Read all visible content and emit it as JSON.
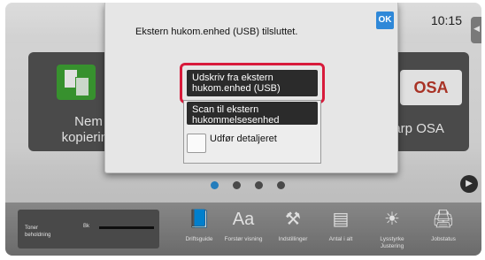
{
  "status": {
    "time": "10:15"
  },
  "tiles": {
    "copy": {
      "label_line1": "Nem",
      "label_line2": "kopiering"
    },
    "osa": {
      "label": "harp OSA",
      "logo_text": "OSA"
    }
  },
  "dialog": {
    "title": "Ekstern hukom.enhed (USB) tilsluttet.",
    "ok_label": "OK",
    "print_option": {
      "line1": "Udskriv fra ekstern",
      "line2": "hukom.enhed (USB)"
    },
    "scan_option": {
      "line1": "Scan til ekstern",
      "line2": "hukommelsesenhed"
    },
    "checkbox_label": "Udfør detaljeret"
  },
  "bottom_bar": {
    "toner": {
      "label_line1": "Toner",
      "label_line2": "beholdning",
      "channel": "Bk",
      "level": 1.0
    },
    "functions": [
      {
        "icon": "guide-icon",
        "label_line1": "Driftsguide",
        "label_line2": ""
      },
      {
        "icon": "magnify-text-icon",
        "label_line1": "Forstør visning",
        "label_line2": ""
      },
      {
        "icon": "tools-icon",
        "label_line1": "Indstillinger",
        "label_line2": ""
      },
      {
        "icon": "counter-icon",
        "label_line1": "Antal i alt",
        "label_line2": ""
      },
      {
        "icon": "brightness-icon",
        "label_line1": "Lysstyrke",
        "label_line2": "Justering"
      },
      {
        "icon": "job-status-icon",
        "label_line1": "Jobstatus",
        "label_line2": ""
      }
    ]
  },
  "pager": {
    "pages": 4,
    "current": 1
  },
  "colors": {
    "accent": "#2f88d8",
    "highlight": "#d81b3b",
    "copy_green": "#3fa535"
  }
}
